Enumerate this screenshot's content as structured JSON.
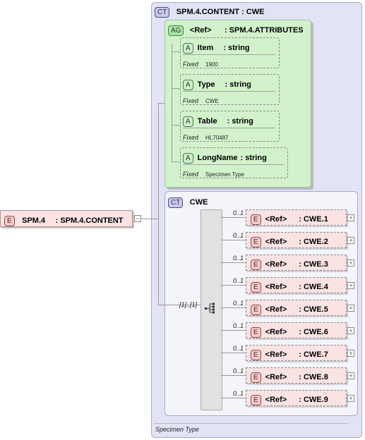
{
  "root_element": {
    "badge": "E",
    "name": "SPM.4",
    "type": ": SPM.4.CONTENT"
  },
  "complex_type": {
    "badge": "CT",
    "title": "SPM.4.CONTENT : CWE",
    "footer_text": "Specimen Type"
  },
  "attribute_group": {
    "badge": "AG",
    "ref": "<Ref>",
    "type": ": SPM.4.ATTRIBUTES",
    "attributes": [
      {
        "badge": "A",
        "name": "Item",
        "type": ": string",
        "fixed_label": "Fixed",
        "fixed_value": "1900"
      },
      {
        "badge": "A",
        "name": "Type",
        "type": ": string",
        "fixed_label": "Fixed",
        "fixed_value": "CWE"
      },
      {
        "badge": "A",
        "name": "Table",
        "type": ": string",
        "fixed_label": "Fixed",
        "fixed_value": "HL70487"
      },
      {
        "badge": "A",
        "name": "LongName",
        "type": ": string",
        "fixed_label": "Fixed",
        "fixed_value": "Specimen Type"
      }
    ]
  },
  "cwe_type": {
    "badge": "CT",
    "title": "CWE",
    "sequence_cardinality": "[1]..[1]",
    "elements": [
      {
        "cardinality": "0..1",
        "badge": "E",
        "ref": "<Ref>",
        "type": ": CWE.1"
      },
      {
        "cardinality": "0..1",
        "badge": "E",
        "ref": "<Ref>",
        "type": ": CWE.2"
      },
      {
        "cardinality": "0..1",
        "badge": "E",
        "ref": "<Ref>",
        "type": ": CWE.3"
      },
      {
        "cardinality": "0..1",
        "badge": "E",
        "ref": "<Ref>",
        "type": ": CWE.4"
      },
      {
        "cardinality": "0..1",
        "badge": "E",
        "ref": "<Ref>",
        "type": ": CWE.5"
      },
      {
        "cardinality": "0..1",
        "badge": "E",
        "ref": "<Ref>",
        "type": ": CWE.6"
      },
      {
        "cardinality": "0..1",
        "badge": "E",
        "ref": "<Ref>",
        "type": ": CWE.7"
      },
      {
        "cardinality": "0..1",
        "badge": "E",
        "ref": "<Ref>",
        "type": ": CWE.8"
      },
      {
        "cardinality": "0..1",
        "badge": "E",
        "ref": "<Ref>",
        "type": ": CWE.9"
      }
    ]
  }
}
